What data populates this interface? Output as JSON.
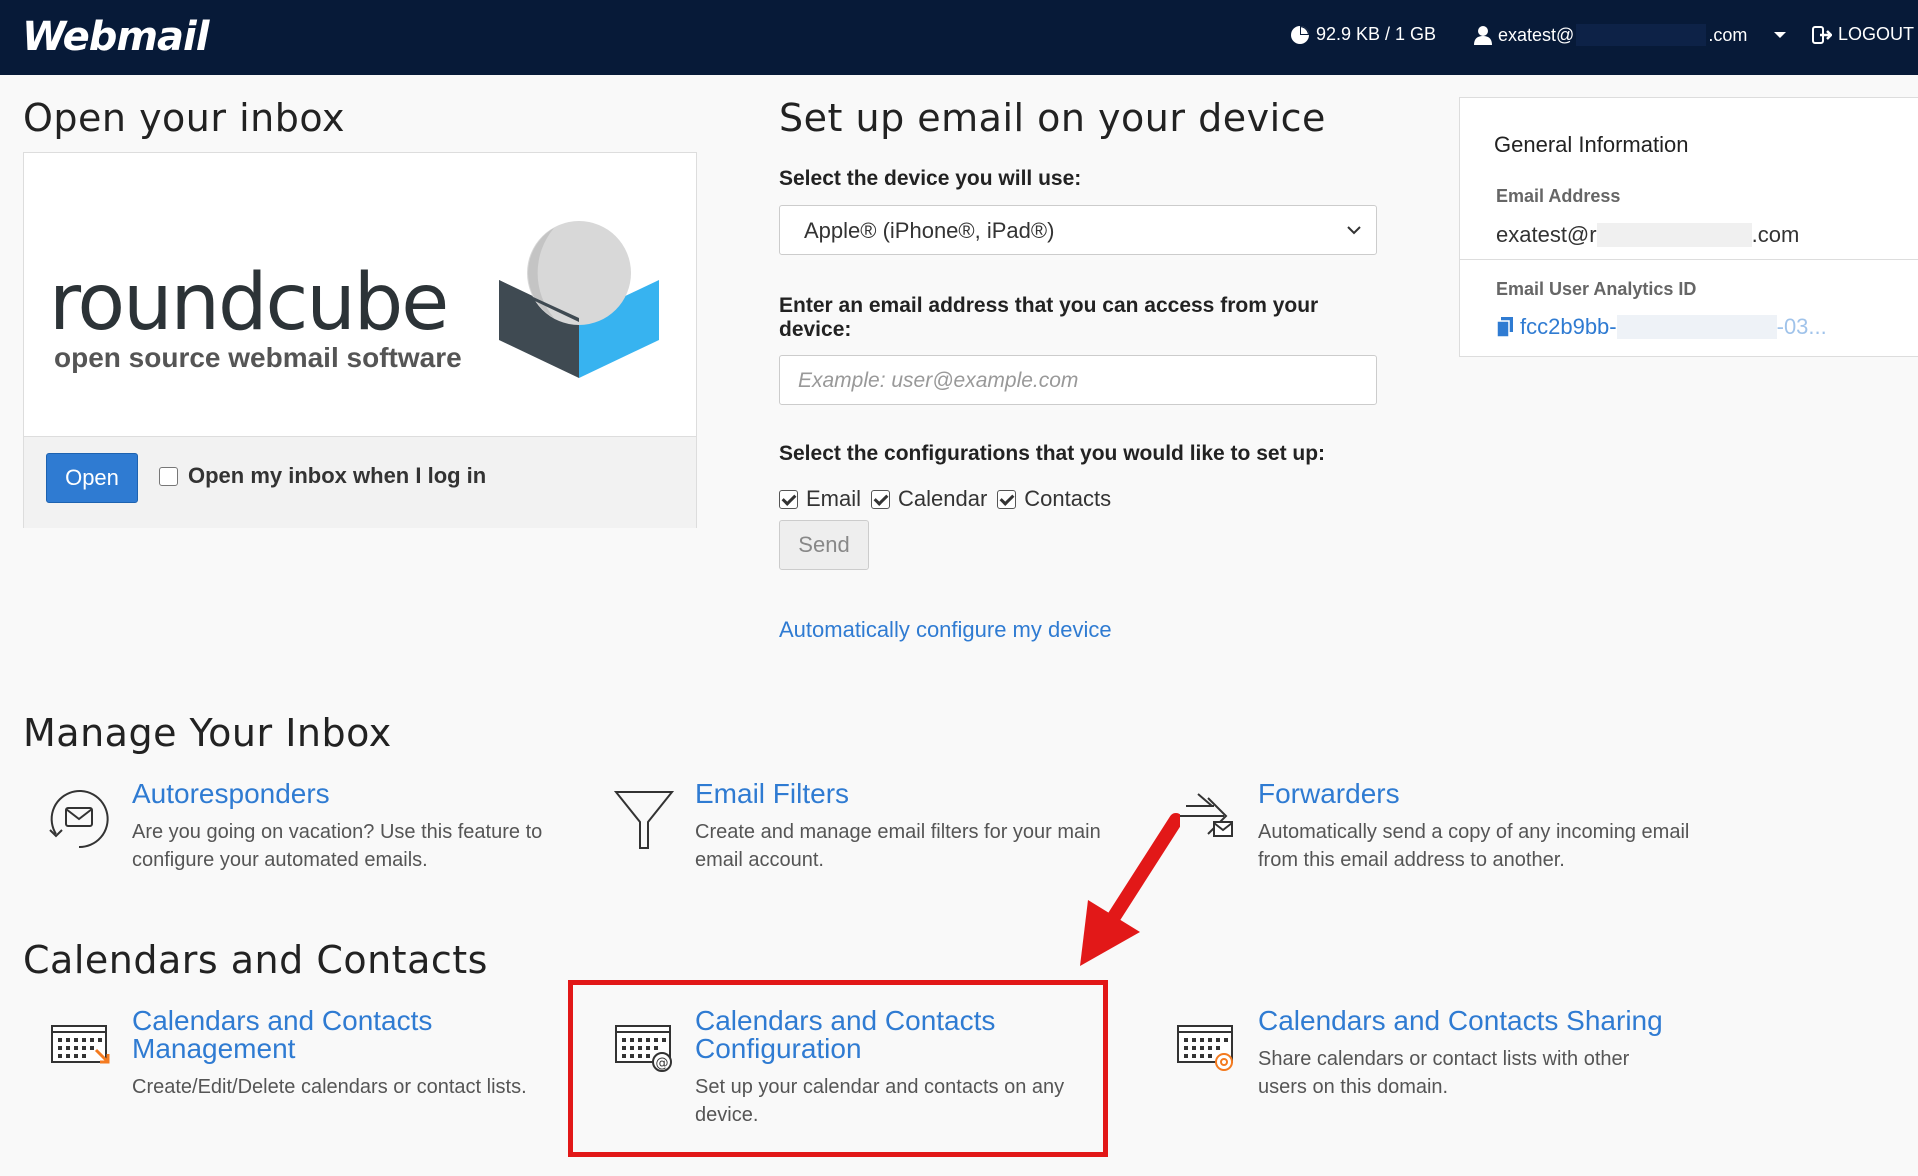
{
  "header": {
    "brand": "Webmail",
    "quota": "92.9 KB / 1 GB",
    "user_prefix": "exatest@",
    "user_suffix": ".com",
    "logout": "LOGOUT"
  },
  "open_inbox": {
    "heading": "Open your inbox",
    "logo_word": "roundcube",
    "logo_sub": "open source webmail software",
    "open_button": "Open",
    "checkbox_label": "Open my inbox when I log in"
  },
  "device_setup": {
    "heading": "Set up email on your device",
    "select_label": "Select the device you will use:",
    "select_value": "Apple® (iPhone®, iPad®)",
    "email_label": "Enter an email address that you can access from your device:",
    "email_placeholder": "Example: user@example.com",
    "config_label": "Select the configurations that you would like to set up:",
    "config_options": [
      "Email",
      "Calendar",
      "Contacts"
    ],
    "send_button": "Send",
    "auto_link": "Automatically configure my device"
  },
  "general_info": {
    "title": "General Information",
    "email_label": "Email Address",
    "email_prefix": "exatest@r",
    "email_suffix": ".com",
    "analytics_label": "Email User Analytics ID",
    "analytics_prefix": "fcc2b9bb-",
    "analytics_suffix": "-03..."
  },
  "manage_inbox": {
    "heading": "Manage Your Inbox",
    "items": [
      {
        "title": "Autoresponders",
        "desc": "Are you going on vacation? Use this feature to configure your automated emails.",
        "icon": "autoresponder-icon"
      },
      {
        "title": "Email Filters",
        "desc": "Create and manage email filters for your main email account.",
        "icon": "filter-icon"
      },
      {
        "title": "Forwarders",
        "desc": "Automatically send a copy of any incoming email from this email address to another.",
        "icon": "forwarder-icon"
      }
    ]
  },
  "calendars_contacts": {
    "heading": "Calendars and Contacts",
    "items": [
      {
        "title": "Calendars and Contacts Management",
        "desc": "Create/Edit/Delete calendars or contact lists.",
        "icon": "calendar-manage-icon"
      },
      {
        "title": "Calendars and Contacts Configuration",
        "desc": "Set up your calendar and contacts on any device.",
        "icon": "calendar-config-icon"
      },
      {
        "title": "Calendars and Contacts Sharing",
        "desc": "Share calendars or contact lists with other users on this domain.",
        "icon": "calendar-share-icon"
      }
    ]
  },
  "colors": {
    "navbar": "#071a38",
    "link": "#2f7bd2",
    "highlight": "#e21818",
    "accent_orange": "#f47b20"
  }
}
